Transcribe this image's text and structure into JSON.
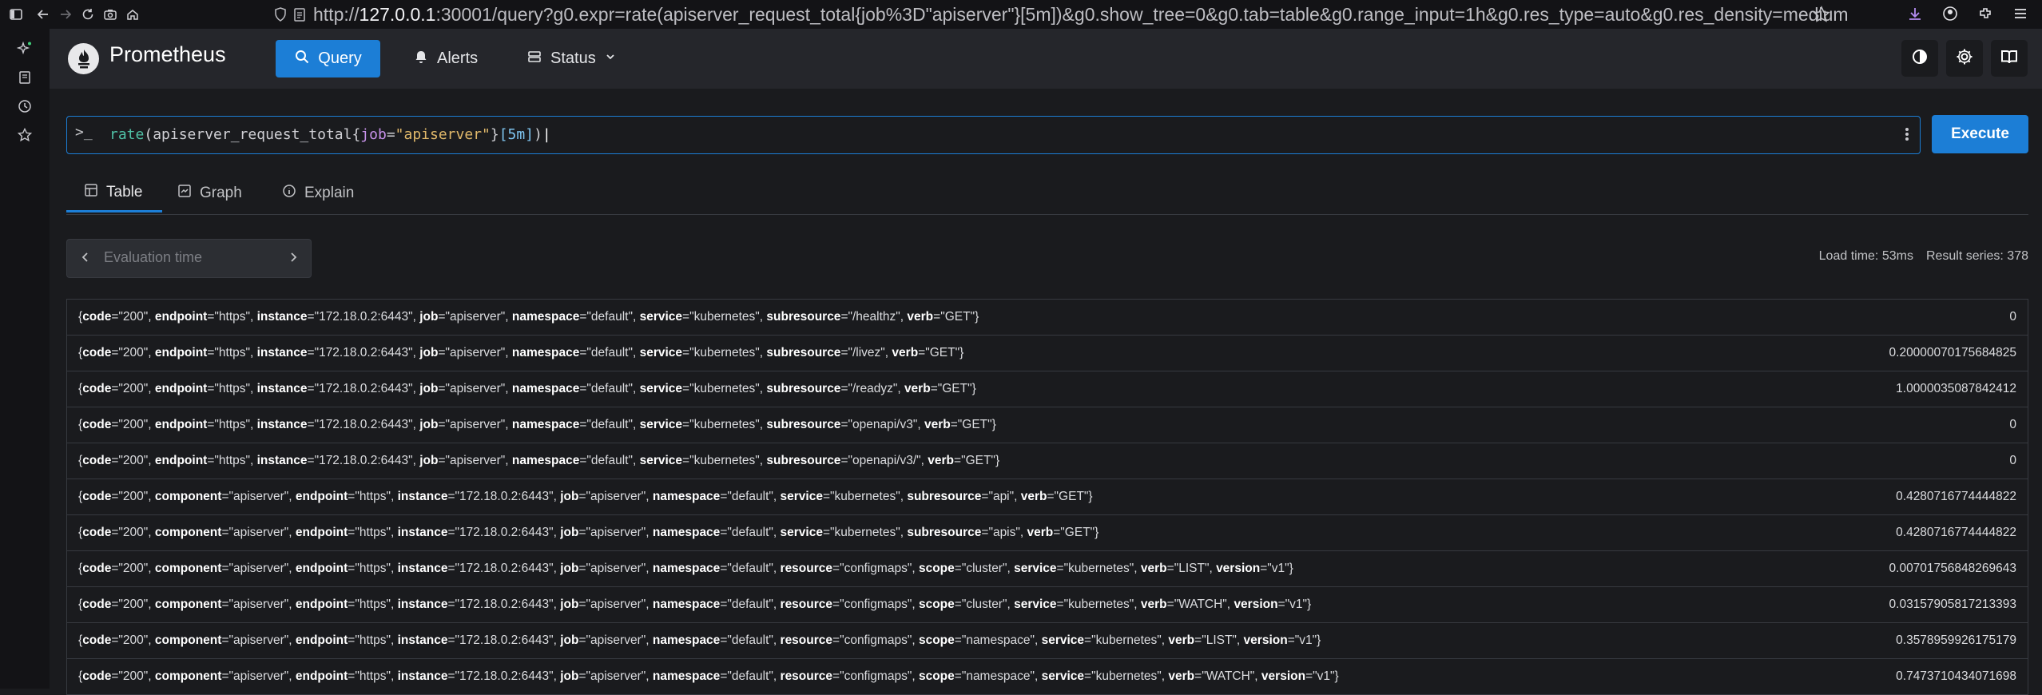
{
  "browser": {
    "url_prefix": "http://",
    "url_host": "127.0.0.1",
    "url_rest": ":30001/query?g0.expr=rate(apiserver_request_total{job%3D\"apiserver\"}[5m])&g0.show_tree=0&g0.tab=table&g0.range_input=1h&g0.res_type=auto&g0.res_density=medium"
  },
  "app": {
    "brand": "Prometheus",
    "nav": {
      "query": "Query",
      "alerts": "Alerts",
      "status": "Status"
    }
  },
  "query": {
    "fn": "rate",
    "paren_open": "(",
    "metric": "apiserver_request_total",
    "brace_open": "{",
    "label": "job",
    "eq": "=",
    "value": "\"apiserver\"",
    "brace_close": "}",
    "range": "[5m]",
    "paren_close": ")",
    "prompt": ">_",
    "execute_label": "Execute"
  },
  "tabs": {
    "table": "Table",
    "graph": "Graph",
    "explain": "Explain",
    "active": "table"
  },
  "eval": {
    "placeholder": "Evaluation time"
  },
  "stats": {
    "load_time": "Load time: 53ms",
    "result_series": "Result series: 378"
  },
  "results": [
    {
      "labels": [
        [
          "code",
          "200"
        ],
        [
          "endpoint",
          "https"
        ],
        [
          "instance",
          "172.18.0.2:6443"
        ],
        [
          "job",
          "apiserver"
        ],
        [
          "namespace",
          "default"
        ],
        [
          "service",
          "kubernetes"
        ],
        [
          "subresource",
          "/healthz"
        ],
        [
          "verb",
          "GET"
        ]
      ],
      "value": "0"
    },
    {
      "labels": [
        [
          "code",
          "200"
        ],
        [
          "endpoint",
          "https"
        ],
        [
          "instance",
          "172.18.0.2:6443"
        ],
        [
          "job",
          "apiserver"
        ],
        [
          "namespace",
          "default"
        ],
        [
          "service",
          "kubernetes"
        ],
        [
          "subresource",
          "/livez"
        ],
        [
          "verb",
          "GET"
        ]
      ],
      "value": "0.20000070175684825"
    },
    {
      "labels": [
        [
          "code",
          "200"
        ],
        [
          "endpoint",
          "https"
        ],
        [
          "instance",
          "172.18.0.2:6443"
        ],
        [
          "job",
          "apiserver"
        ],
        [
          "namespace",
          "default"
        ],
        [
          "service",
          "kubernetes"
        ],
        [
          "subresource",
          "/readyz"
        ],
        [
          "verb",
          "GET"
        ]
      ],
      "value": "1.0000035087842412"
    },
    {
      "labels": [
        [
          "code",
          "200"
        ],
        [
          "endpoint",
          "https"
        ],
        [
          "instance",
          "172.18.0.2:6443"
        ],
        [
          "job",
          "apiserver"
        ],
        [
          "namespace",
          "default"
        ],
        [
          "service",
          "kubernetes"
        ],
        [
          "subresource",
          "openapi/v3"
        ],
        [
          "verb",
          "GET"
        ]
      ],
      "value": "0"
    },
    {
      "labels": [
        [
          "code",
          "200"
        ],
        [
          "endpoint",
          "https"
        ],
        [
          "instance",
          "172.18.0.2:6443"
        ],
        [
          "job",
          "apiserver"
        ],
        [
          "namespace",
          "default"
        ],
        [
          "service",
          "kubernetes"
        ],
        [
          "subresource",
          "openapi/v3/"
        ],
        [
          "verb",
          "GET"
        ]
      ],
      "value": "0"
    },
    {
      "labels": [
        [
          "code",
          "200"
        ],
        [
          "component",
          "apiserver"
        ],
        [
          "endpoint",
          "https"
        ],
        [
          "instance",
          "172.18.0.2:6443"
        ],
        [
          "job",
          "apiserver"
        ],
        [
          "namespace",
          "default"
        ],
        [
          "service",
          "kubernetes"
        ],
        [
          "subresource",
          "api"
        ],
        [
          "verb",
          "GET"
        ]
      ],
      "value": "0.4280716774444822"
    },
    {
      "labels": [
        [
          "code",
          "200"
        ],
        [
          "component",
          "apiserver"
        ],
        [
          "endpoint",
          "https"
        ],
        [
          "instance",
          "172.18.0.2:6443"
        ],
        [
          "job",
          "apiserver"
        ],
        [
          "namespace",
          "default"
        ],
        [
          "service",
          "kubernetes"
        ],
        [
          "subresource",
          "apis"
        ],
        [
          "verb",
          "GET"
        ]
      ],
      "value": "0.4280716774444822"
    },
    {
      "labels": [
        [
          "code",
          "200"
        ],
        [
          "component",
          "apiserver"
        ],
        [
          "endpoint",
          "https"
        ],
        [
          "instance",
          "172.18.0.2:6443"
        ],
        [
          "job",
          "apiserver"
        ],
        [
          "namespace",
          "default"
        ],
        [
          "resource",
          "configmaps"
        ],
        [
          "scope",
          "cluster"
        ],
        [
          "service",
          "kubernetes"
        ],
        [
          "verb",
          "LIST"
        ],
        [
          "version",
          "v1"
        ]
      ],
      "value": "0.00701756848269643"
    },
    {
      "labels": [
        [
          "code",
          "200"
        ],
        [
          "component",
          "apiserver"
        ],
        [
          "endpoint",
          "https"
        ],
        [
          "instance",
          "172.18.0.2:6443"
        ],
        [
          "job",
          "apiserver"
        ],
        [
          "namespace",
          "default"
        ],
        [
          "resource",
          "configmaps"
        ],
        [
          "scope",
          "cluster"
        ],
        [
          "service",
          "kubernetes"
        ],
        [
          "verb",
          "WATCH"
        ],
        [
          "version",
          "v1"
        ]
      ],
      "value": "0.03157905817213393"
    },
    {
      "labels": [
        [
          "code",
          "200"
        ],
        [
          "component",
          "apiserver"
        ],
        [
          "endpoint",
          "https"
        ],
        [
          "instance",
          "172.18.0.2:6443"
        ],
        [
          "job",
          "apiserver"
        ],
        [
          "namespace",
          "default"
        ],
        [
          "resource",
          "configmaps"
        ],
        [
          "scope",
          "namespace"
        ],
        [
          "service",
          "kubernetes"
        ],
        [
          "verb",
          "LIST"
        ],
        [
          "version",
          "v1"
        ]
      ],
      "value": "0.3578959926175179"
    },
    {
      "labels": [
        [
          "code",
          "200"
        ],
        [
          "component",
          "apiserver"
        ],
        [
          "endpoint",
          "https"
        ],
        [
          "instance",
          "172.18.0.2:6443"
        ],
        [
          "job",
          "apiserver"
        ],
        [
          "namespace",
          "default"
        ],
        [
          "resource",
          "configmaps"
        ],
        [
          "scope",
          "namespace"
        ],
        [
          "service",
          "kubernetes"
        ],
        [
          "verb",
          "WATCH"
        ],
        [
          "version",
          "v1"
        ]
      ],
      "value": "0.7473710434071698"
    }
  ]
}
